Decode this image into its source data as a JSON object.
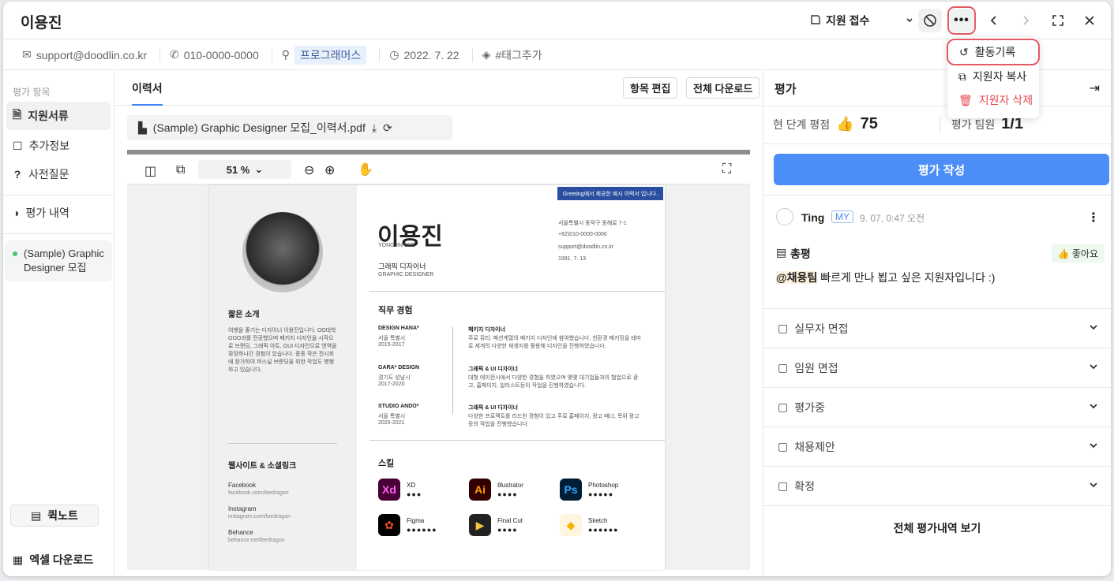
{
  "header": {
    "name": "이용진",
    "stage_label": "지원 접수"
  },
  "info": {
    "email": "support@doodlin.co.kr",
    "phone": "010-0000-0000",
    "source": "프로그래머스",
    "date": "2022. 7. 22",
    "tag": "#태그추가"
  },
  "sidebar": {
    "caption": "평가 항목",
    "items": [
      {
        "label": "지원서류"
      },
      {
        "label": "추가정보"
      },
      {
        "label": "사전질문"
      }
    ],
    "history": "평가 내역",
    "posting": "(Sample) Graphic Designer 모집",
    "quicknote": "퀵노트",
    "excel": "엑셀 다운로드"
  },
  "main": {
    "tab": "이력서",
    "edit_btn": "항목 편집",
    "download_btn": "전체 다운로드",
    "file_name": "(Sample) Graphic Designer 모집_이력서.pdf",
    "zoom": "51 %"
  },
  "resume": {
    "banner": "Greeting에서 제공한 예시 이력서 입니다.",
    "name": "이용진",
    "name_en": "YONGJIN LEE",
    "role": "그래픽 디자이너",
    "role_en": "GRAPHIC DESIGNER",
    "address": "서울특별시 동작구 동해로 7-1",
    "phone": "+82)010-0000-0000",
    "email": "support@doodlin.co.kr",
    "birth": "1991. 7. 13",
    "intro_title": "짧은 소개",
    "intro_text": "여행을 좋기는 디자이너 이용진입니다. OO대학 OOO과를 전공했으며 패키지 디자인을 시작으로 브랜딩, 그래픽 아트, GUI 디자인으로 영역을 확장하나간 경험이 있습니다. 종종 작은 전시회에 참가하여 퍼스널 브랜딩을 위한 작업도 병행하고 있습니다.",
    "links_title": "웹사이트 & 소셜링크",
    "links": [
      {
        "name": "Facebook",
        "url": "facebook.com/leedragon"
      },
      {
        "name": "Instagram",
        "url": "instagram.com/leedragon"
      },
      {
        "name": "Behance",
        "url": "behance.net/leedragon"
      }
    ],
    "career_title": "직무 경험",
    "career": [
      {
        "company": "DESIGN HANA*",
        "loc": "서울 특별시",
        "period": "2015-2017",
        "role": "패키지 디자이너",
        "desc": "주로 뮤티, 패션계열의 패키지 디자인에 참여했습니다. 친환경 패키징을 테마로 세계의 다양한 재생지를 활용해 디자인을 진행하였습니다."
      },
      {
        "company": "GARA* DESIGN",
        "loc": "경기도 성남시",
        "period": "2017-2020",
        "role": "그래픽 & UI 디자이너",
        "desc": "대형 에이전시에서 다양한 경험을 하였으며 몇몇 대기업들과의 협업으로 광고, 홈페이지, 일러스트등의 작업을 진행하였습니다."
      },
      {
        "company": "STUDIO ANDO*",
        "loc": "서울 특별시",
        "period": "2020-2021",
        "role": "그래픽 & UI 디자이너",
        "desc": "다양한 프로젝트를 리드한 경험이 있고 주로 홈페이지, 광고 배너, 목위 광고 등의 작업을 진행했습니다."
      }
    ],
    "skills_title": "스킬",
    "skills": [
      {
        "name": "XD",
        "abbr": "Xd",
        "bg": "#470137",
        "fg": "#ff61f6",
        "level": 3
      },
      {
        "name": "Illustrator",
        "abbr": "Ai",
        "bg": "#330000",
        "fg": "#ff9a00",
        "level": 4
      },
      {
        "name": "Photoshop",
        "abbr": "Ps",
        "bg": "#001e36",
        "fg": "#31a8ff",
        "level": 5
      },
      {
        "name": "Figma",
        "abbr": "✿",
        "bg": "#000000",
        "fg": "#f24e1e",
        "level": 6
      },
      {
        "name": "Final Cut",
        "abbr": "▶",
        "bg": "#222222",
        "fg": "#f4c542",
        "level": 4
      },
      {
        "name": "Sketch",
        "abbr": "◆",
        "bg": "#fff6e0",
        "fg": "#f7b500",
        "level": 6
      }
    ]
  },
  "eval": {
    "title": "평가",
    "score_label": "현 단계 평점",
    "score": "75",
    "team_label": "평가 팀원",
    "team": "1/1",
    "write_btn": "평가 작성",
    "comment": {
      "author": "Ting",
      "my": "MY",
      "time": "9. 07, 0:47 오전",
      "category": "총평",
      "reaction": "좋아요",
      "mention": "@채용팀",
      "text": "빠르게 만나 뵙고 싶은 지원자입니다 :)"
    },
    "stages": [
      "실무자 면접",
      "임원 면접",
      "평가중",
      "채용제안",
      "확정"
    ],
    "all_btn": "전체 평가내역 보기"
  },
  "menu": {
    "items": [
      "활동기록",
      "지원자 복사",
      "지원자 삭제"
    ]
  },
  "colors": {
    "accent": "#4c8ef7",
    "danger": "#e5484d",
    "highlight": "#e35a63"
  }
}
